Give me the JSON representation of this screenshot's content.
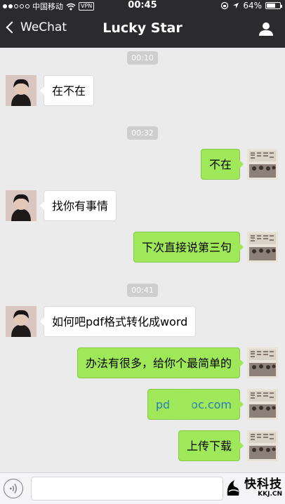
{
  "status_bar": {
    "carrier": "中国移动",
    "vpn": "VPN",
    "time": "00:45",
    "battery": "64%",
    "battery_level": 0.64
  },
  "nav": {
    "back_label": "WeChat",
    "title": "Lucky Star"
  },
  "timestamps": [
    "00:10",
    "00:32",
    "00:41"
  ],
  "messages": [
    {
      "side": "left",
      "text": "在不在"
    },
    {
      "side": "right",
      "text": "不在"
    },
    {
      "side": "left",
      "text": "找你有事情"
    },
    {
      "side": "right",
      "text": "下次直接说第三句"
    },
    {
      "side": "left",
      "text": "如何吧pdf格式转化成word"
    },
    {
      "side": "right",
      "text": "办法有很多，给你个最简单的"
    },
    {
      "side": "right",
      "text_a": "pd",
      "text_b": "oc.com"
    },
    {
      "side": "right",
      "text": "上传下载"
    }
  ],
  "watermark": {
    "text": "快科技",
    "sub": "KKJ.CN"
  },
  "colors": {
    "bar": "#2b2b2e",
    "background": "#ebebeb",
    "my_bubble": "#9ee85a",
    "their_bubble": "#ffffff"
  }
}
